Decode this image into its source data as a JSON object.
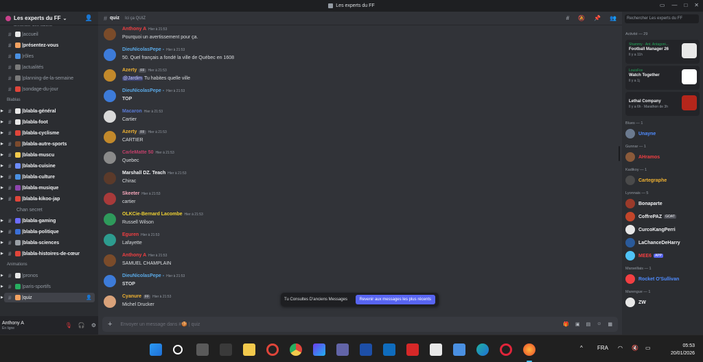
{
  "window": {
    "title": "Les experts du FF"
  },
  "server": {
    "name": "Les experts du FF",
    "partial_top": "annoncer-des-salons"
  },
  "channels": [
    {
      "name": "accueil",
      "emoji_color": "#e8e8e8",
      "bold": false
    },
    {
      "name": "présentez-vous",
      "emoji_color": "#f4a261",
      "bold": true
    },
    {
      "name": "rôles",
      "emoji_color": "#4a90e2",
      "bold": false
    },
    {
      "name": "actualités",
      "emoji_color": "#7a7a7a",
      "bold": false
    },
    {
      "name": "planning-de-la-semaine",
      "emoji_color": "#7a7a7a",
      "bold": false
    },
    {
      "name": "sondage-du-jour",
      "emoji_color": "#e0453a",
      "bold": false
    }
  ],
  "categories": {
    "blablas": "Blablas",
    "animations": "Animations"
  },
  "blablas_channels": [
    {
      "name": "blabla-général",
      "emoji_color": "#e8e8e8"
    },
    {
      "name": "blabla-foot",
      "emoji_color": "#e8e8e8"
    },
    {
      "name": "blabla-cyclisme",
      "emoji_color": "#e0453a"
    },
    {
      "name": "blabla-autre-sports",
      "emoji_color": "#7c4a2d"
    },
    {
      "name": "blabla-muscu",
      "emoji_color": "#f2c94c"
    },
    {
      "name": "blabla-cuisine",
      "emoji_color": "#6c8cff"
    },
    {
      "name": "blabla-culture",
      "emoji_color": "#4a90e2"
    },
    {
      "name": "blabla-musique",
      "emoji_color": "#8e44ad"
    },
    {
      "name": "blabla-kikoo-jap",
      "emoji_color": "#e0453a"
    }
  ],
  "thread": {
    "name": "Chan secret"
  },
  "blablas_channels_2": [
    {
      "name": "blabla-gaming",
      "emoji_color": "#6c6cff"
    },
    {
      "name": "blabla-politique",
      "emoji_color": "#3b6fd8"
    },
    {
      "name": "blabla-sciences",
      "emoji_color": "#9aa0a6"
    },
    {
      "name": "blabla-histoires-de-cœur",
      "emoji_color": "#e0453a"
    }
  ],
  "animations_channels": [
    {
      "name": "pronos",
      "emoji_color": "#e8e8e8"
    },
    {
      "name": "paris-sportifs",
      "emoji_color": "#27ae60"
    },
    {
      "name": "quiz",
      "emoji_color": "#f4a261"
    }
  ],
  "user": {
    "name": "Anthony A",
    "status": "En ligne"
  },
  "header": {
    "channel": "quiz",
    "topic": "Ici ça QUIZ"
  },
  "search_placeholder": "Rechercher Les experts du FF",
  "messages": [
    {
      "author": "Anthony A",
      "color": "#f23f42",
      "time": "Hier à 21:53",
      "text": "Pourquoi un avertissement pour ça.",
      "strong": false,
      "avatar": "#7a4b2a",
      "badge": ""
    },
    {
      "author": "DieuNicolasPepe -",
      "color": "#5aa9e6",
      "time": "Hier à 21:53",
      "text": "50. Quel français a fondé la ville de Québec en 1608",
      "strong": false,
      "avatar": "#3d7bd9",
      "badge": ""
    },
    {
      "author": "Azerty",
      "color": "#f0b232",
      "time": "Hier à 21:53",
      "text": "Tu habites quelle ville",
      "mention": "@Jardim",
      "strong": false,
      "avatar": "#c2892b",
      "badge": "FF"
    },
    {
      "author": "DieuNicolasPepe -",
      "color": "#5aa9e6",
      "time": "Hier à 21:53",
      "text": "TOP",
      "strong": true,
      "avatar": "#3d7bd9",
      "badge": ""
    },
    {
      "author": "Macaron",
      "color": "#5a7bd6",
      "time": "Hier à 21:53",
      "text": "Cartier",
      "strong": false,
      "avatar": "#d9d9d9",
      "badge": ""
    },
    {
      "author": "Azerty",
      "color": "#f0b232",
      "time": "Hier à 21:53",
      "text": "CARTIER",
      "strong": false,
      "avatar": "#c2892b",
      "badge": "FF"
    },
    {
      "author": "CarleMatte 50",
      "color": "#c2416b",
      "time": "Hier à 21:53",
      "text": "Quebec",
      "strong": false,
      "avatar": "#8a8a8a",
      "badge": ""
    },
    {
      "author": "Marshall DZ. Teach",
      "color": "#f2f3f5",
      "time": "Hier à 21:53",
      "text": "Chirac",
      "strong": false,
      "avatar": "#5b3a2a",
      "badge": ""
    },
    {
      "author": "Skeeter",
      "color": "#f2a5b8",
      "time": "Hier à 21:53",
      "text": "cartier",
      "strong": false,
      "avatar": "#a83a3a",
      "badge": ""
    },
    {
      "author": "OLKCie-Bernard Lacombe",
      "color": "#f0d232",
      "time": "Hier à 21:53",
      "text": "Russell Wilson",
      "strong": false,
      "avatar": "#2e9a5b",
      "badge": ""
    },
    {
      "author": "Eguren",
      "color": "#f23f42",
      "time": "Hier à 21:53",
      "text": "Lafayette",
      "strong": false,
      "avatar": "#2d9c8f",
      "badge": ""
    },
    {
      "author": "Anthony A",
      "color": "#f23f42",
      "time": "Hier à 21:53",
      "text": "SAMUEL CHAMPLAIN",
      "strong": false,
      "avatar": "#7a4b2a",
      "badge": ""
    },
    {
      "author": "DieuNicolasPepe -",
      "color": "#5aa9e6",
      "time": "Hier à 21:53",
      "text": "STOP",
      "strong": true,
      "avatar": "#3d7bd9",
      "badge": ""
    },
    {
      "author": "Cyanure",
      "color": "#f0b232",
      "time": "Hier à 21:53",
      "text": "Michel Drucker",
      "strong": false,
      "avatar": "#d9a27a",
      "badge": "FF"
    }
  ],
  "old_messages": {
    "text": "Tu Consultes D'anciens Messages",
    "button": "Revenir aux messages les plus récents"
  },
  "composer": {
    "placeholder": "Envoyer un message dans #🍪 | quiz"
  },
  "members": {
    "activity_header": "Activité — 29",
    "activities": [
      {
        "line1": "Shammy · Ant. Antagoni...",
        "line2": "Football Manager 26",
        "line3": "Il y a 11h",
        "thumb": "#e8e8e8"
      },
      {
        "line1": "LouisFox",
        "line2": "Watch Together",
        "line3": "Il y a 1j",
        "thumb": "#ffffff"
      },
      {
        "line1": "",
        "line2": "Lethal Company",
        "line3": "Il y a 6h · Marathon de 3h",
        "thumb": "#b5261b"
      }
    ],
    "groups": [
      {
        "title": "Blues — 1",
        "items": [
          {
            "name": "Unayne",
            "color": "#4f8cff",
            "av": "#6b7a8f"
          }
        ]
      },
      {
        "title": "Gunnar — 1",
        "items": [
          {
            "name": "AHramos",
            "color": "#f23f42",
            "av": "#8a5a3a"
          }
        ]
      },
      {
        "title": "Kadikoy — 1",
        "items": [
          {
            "name": "Cartegraphe",
            "color": "#f0b232",
            "av": "#4a4a4a"
          }
        ]
      },
      {
        "title": "Lyonnais — 5",
        "items": [
          {
            "name": "Bonaparte",
            "color": "#f2f3f5",
            "av": "#9a3a2a"
          },
          {
            "name": "CoffrePAZ",
            "color": "#f2f3f5",
            "av": "#c2452a",
            "tag": "GOAT"
          },
          {
            "name": "CurcoKangPerri",
            "color": "#f2f3f5",
            "av": "#e8e8e8"
          },
          {
            "name": "LaChanceDeHarry",
            "color": "#f2f3f5",
            "av": "#2a5a9a"
          },
          {
            "name": "MEE6",
            "color": "#f23f42",
            "av": "#4fc3f7",
            "app": "APP"
          }
        ]
      },
      {
        "title": "Marseillais — 1",
        "items": [
          {
            "name": "Rocket O'Sullivan",
            "color": "#4f8cff",
            "av": "#f23f42"
          }
        ]
      },
      {
        "title": "Marengue — 1",
        "items": [
          {
            "name": "ZW",
            "color": "#f2f3f5",
            "av": "#e8e8e8"
          }
        ]
      }
    ]
  },
  "taskbar": {
    "lang": "FRA",
    "time": "05:53",
    "date": "20/01/2026"
  }
}
